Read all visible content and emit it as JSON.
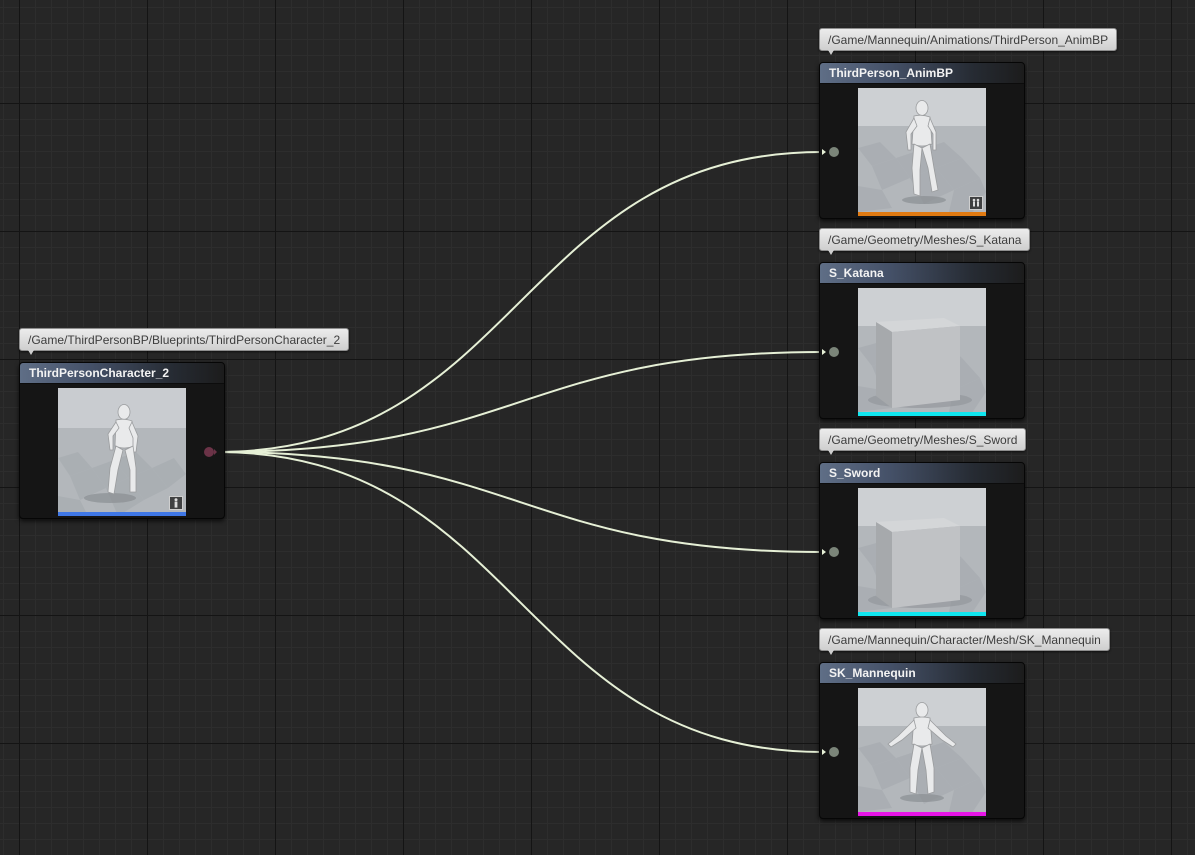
{
  "graph": {
    "source": {
      "title": "ThirdPersonCharacter_2",
      "path": "/Game/ThirdPersonBP/Blueprints/ThirdPersonCharacter_2",
      "thumbnail": "mannequin-walking",
      "badge_icon": "character-icon",
      "accent_color": "#3f77e6"
    },
    "dependencies": [
      {
        "title": "ThirdPerson_AnimBP",
        "path": "/Game/Mannequin/Animations/ThirdPerson_AnimBP",
        "thumbnail": "mannequin-walking",
        "badge_icon": "anim-blueprint-icon",
        "accent_color": "#e07a12"
      },
      {
        "title": "S_Katana",
        "path": "/Game/Geometry/Meshes/S_Katana",
        "thumbnail": "static-mesh-cube",
        "accent_color": "#10e6ef"
      },
      {
        "title": "S_Sword",
        "path": "/Game/Geometry/Meshes/S_Sword",
        "thumbnail": "static-mesh-cube",
        "accent_color": "#10e6ef"
      },
      {
        "title": "SK_Mannequin",
        "path": "/Game/Mannequin/Character/Mesh/SK_Mannequin",
        "thumbnail": "mannequin-a-pose",
        "accent_color": "#e615e6"
      }
    ],
    "wire_color": "#e6f0d6",
    "output_pin_color": "#6b3347",
    "input_pin_color": "#7b8579"
  }
}
